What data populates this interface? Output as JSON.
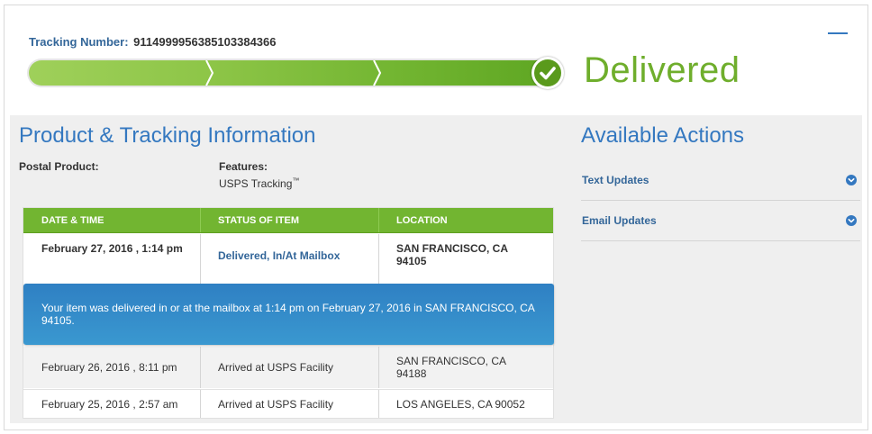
{
  "tracking": {
    "label": "Tracking Number:",
    "number": "9114999956385103384366"
  },
  "progress": {
    "fraction": 1.0,
    "stages": 3,
    "status": "Delivered",
    "status_color": "#6fae2c"
  },
  "product_section": {
    "title": "Product & Tracking Information",
    "postal_product_label": "Postal Product:",
    "postal_product_value": "",
    "features_label": "Features:",
    "features_value": "USPS Tracking",
    "features_mark": "™"
  },
  "table": {
    "headers": [
      "DATE & TIME",
      "STATUS OF ITEM",
      "LOCATION"
    ],
    "rows": [
      {
        "date": "February 27, 2016 , 1:14 pm",
        "status": "Delivered, In/At Mailbox",
        "location": "SAN FRANCISCO, CA 94105"
      },
      {
        "date": "February 26, 2016 , 8:11 pm",
        "status": "Arrived at USPS Facility",
        "location": "SAN FRANCISCO, CA 94188"
      },
      {
        "date": "February 25, 2016 , 2:57 am",
        "status": "Arrived at USPS Facility",
        "location": "LOS ANGELES, CA 90052"
      }
    ],
    "header_color": "#72b531"
  },
  "callout": {
    "text": "Your item was delivered in or at the mailbox at 1:14 pm on February 27, 2016 in SAN FRANCISCO, CA 94105.",
    "color": "#3a8fcd"
  },
  "actions": {
    "title": "Available Actions",
    "items": [
      {
        "label": "Text Updates",
        "icon": "chevron-down-circle-icon"
      },
      {
        "label": "Email Updates",
        "icon": "chevron-down-circle-icon"
      }
    ]
  },
  "icons": {
    "collapse": "minus-icon",
    "delivered": "checkmark-icon"
  },
  "colors": {
    "accent_blue": "#3478c0",
    "green": "#72b531"
  }
}
